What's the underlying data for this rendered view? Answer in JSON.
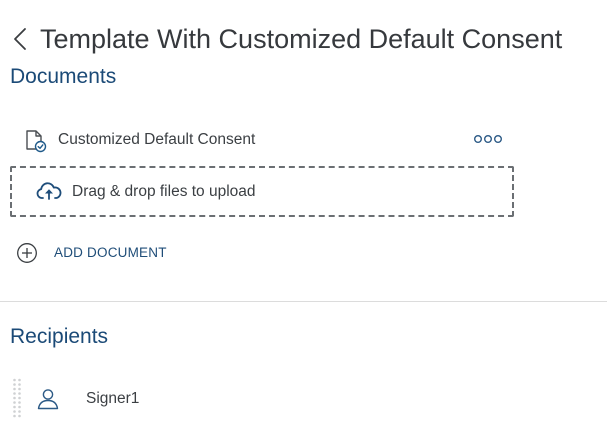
{
  "header": {
    "back_icon": "chevron-left-icon",
    "title": "Template With Customized Default Consent"
  },
  "documents": {
    "heading": "Documents",
    "items": [
      {
        "name": "Customized Default Consent",
        "icon": "document-check-icon",
        "menu_icon": "more-options-icon"
      }
    ],
    "dropzone": {
      "icon": "cloud-upload-icon",
      "label": "Drag & drop files to upload"
    },
    "add_document": {
      "icon": "plus-circle-icon",
      "label": "ADD DOCUMENT"
    }
  },
  "recipients": {
    "heading": "Recipients",
    "items": [
      {
        "name": "Signer1",
        "icon": "person-icon"
      }
    ]
  },
  "colors": {
    "heading": "#1b4a77",
    "text": "#3b3f43",
    "accent": "#1f4d78",
    "divider": "#dcdcdc",
    "dash_border": "#6b6f73"
  }
}
